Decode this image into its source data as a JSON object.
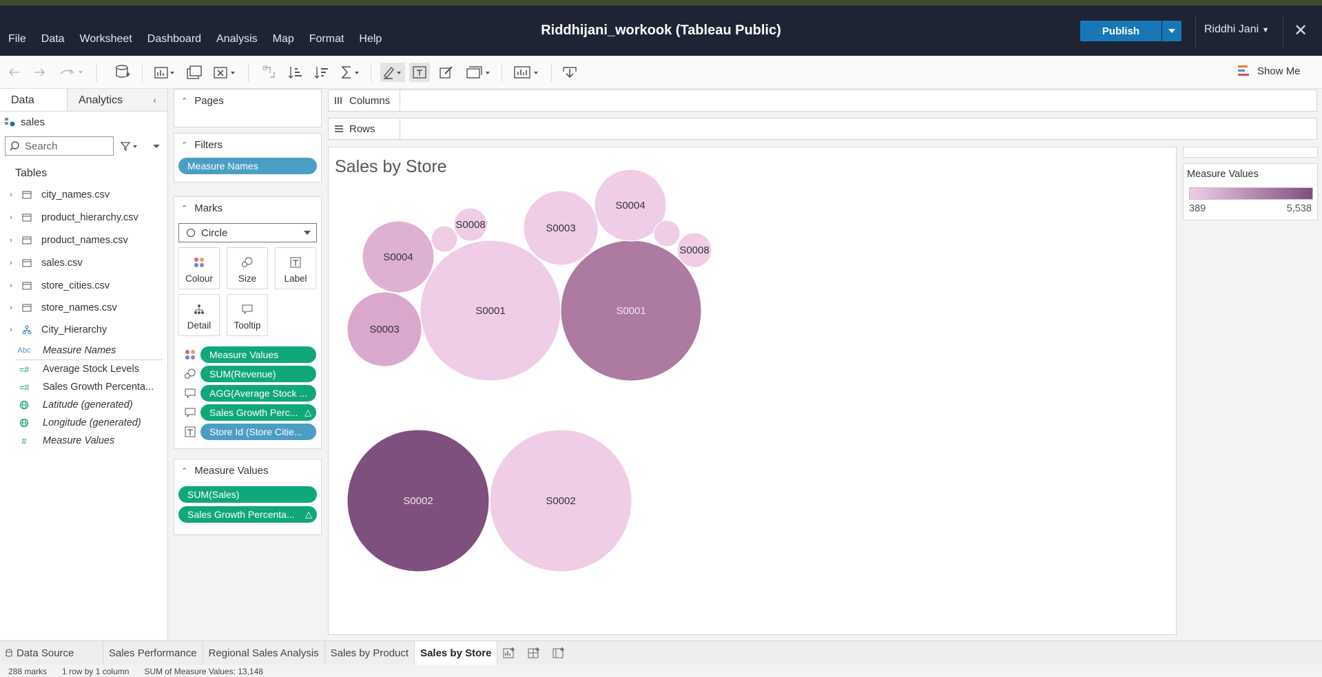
{
  "app": {
    "window_title": "Riddhijani_workook (Tableau Public)",
    "menu": [
      "File",
      "Data",
      "Worksheet",
      "Dashboard",
      "Analysis",
      "Map",
      "Format",
      "Help"
    ],
    "publish_label": "Publish",
    "user_name": "Riddhi Jani",
    "show_me_label": "Show Me"
  },
  "data_pane": {
    "tabs": [
      "Data",
      "Analytics"
    ],
    "datasource": "sales",
    "search_placeholder": "Search",
    "tables_heading": "Tables",
    "tables": [
      "city_names.csv",
      "product_hierarchy.csv",
      "product_names.csv",
      "sales.csv",
      "store_cities.csv",
      "store_names.csv",
      "City_Hierarchy"
    ],
    "special_fields": [
      {
        "icon": "Abc",
        "name": "Measure Names"
      },
      {
        "icon": "calc-measure",
        "name": "Average Stock Levels"
      },
      {
        "icon": "calc-measure",
        "name": "Sales Growth Percenta..."
      },
      {
        "icon": "globe",
        "name": "Latitude (generated)"
      },
      {
        "icon": "globe",
        "name": "Longitude (generated)"
      },
      {
        "icon": "hash",
        "name": "Measure Values"
      }
    ]
  },
  "shelves": {
    "pages": "Pages",
    "filters": "Filters",
    "filter_pill": "Measure Names",
    "marks": "Marks",
    "mark_type": "Circle",
    "mark_buttons": [
      "Colour",
      "Size",
      "Label",
      "Detail",
      "Tooltip"
    ],
    "mark_fields": [
      {
        "icon": "colour",
        "label": "Measure Values",
        "color": "green"
      },
      {
        "icon": "size",
        "label": "SUM(Revenue)",
        "color": "green"
      },
      {
        "icon": "tooltip",
        "label": "AGG(Average Stock ...",
        "color": "green"
      },
      {
        "icon": "tooltip",
        "label": "Sales Growth Perc...",
        "color": "green",
        "delta": "△"
      },
      {
        "icon": "label",
        "label": "Store Id (Store Citie...",
        "color": "blue"
      }
    ],
    "measure_values_card": "Measure Values",
    "measure_values_pills": [
      {
        "label": "SUM(Sales)"
      },
      {
        "label": "Sales Growth Percenta...",
        "delta": "△"
      }
    ],
    "columns": "Columns",
    "rows": "Rows"
  },
  "viz": {
    "title": "Sales by Store"
  },
  "legend": {
    "title": "Measure Values",
    "min": "389",
    "max": "5,538",
    "color_low": "#efcee7",
    "color_high": "#7f4f7d"
  },
  "chart_data": {
    "type": "packed-bubble",
    "title": "Sales by Store",
    "color_measure": "Measure Values",
    "color_range": [
      389,
      5538
    ],
    "bubbles": [
      {
        "label": "S0002",
        "color": "#7f4f7d"
      },
      {
        "label": "S0002",
        "color": "#efcde7"
      },
      {
        "label": "S0001",
        "color": "#ad7aa1"
      },
      {
        "label": "S0001",
        "color": "#efcde7"
      },
      {
        "label": "S0003",
        "color": "#d9a8cc"
      },
      {
        "label": "S0004",
        "color": "#deb1d2"
      },
      {
        "label": "S0003",
        "color": "#efcde7"
      },
      {
        "label": "S0004",
        "color": "#efcde7"
      },
      {
        "label": "S0008",
        "color": "#efcde7"
      },
      {
        "label": "S0008",
        "color": "#efcde7"
      },
      {
        "label": "",
        "color": "#efcde7"
      },
      {
        "label": "",
        "color": "#efcde7"
      }
    ]
  },
  "sheet_tabs": [
    "Data Source",
    "Sales Performance",
    "Regional Sales Analysis",
    "Sales by Product",
    "Sales by Store"
  ],
  "active_sheet": "Sales by Store",
  "status": {
    "marks": "288 marks",
    "dims": "1 row by 1 column",
    "sum": "SUM of Measure Values: 13,148"
  }
}
